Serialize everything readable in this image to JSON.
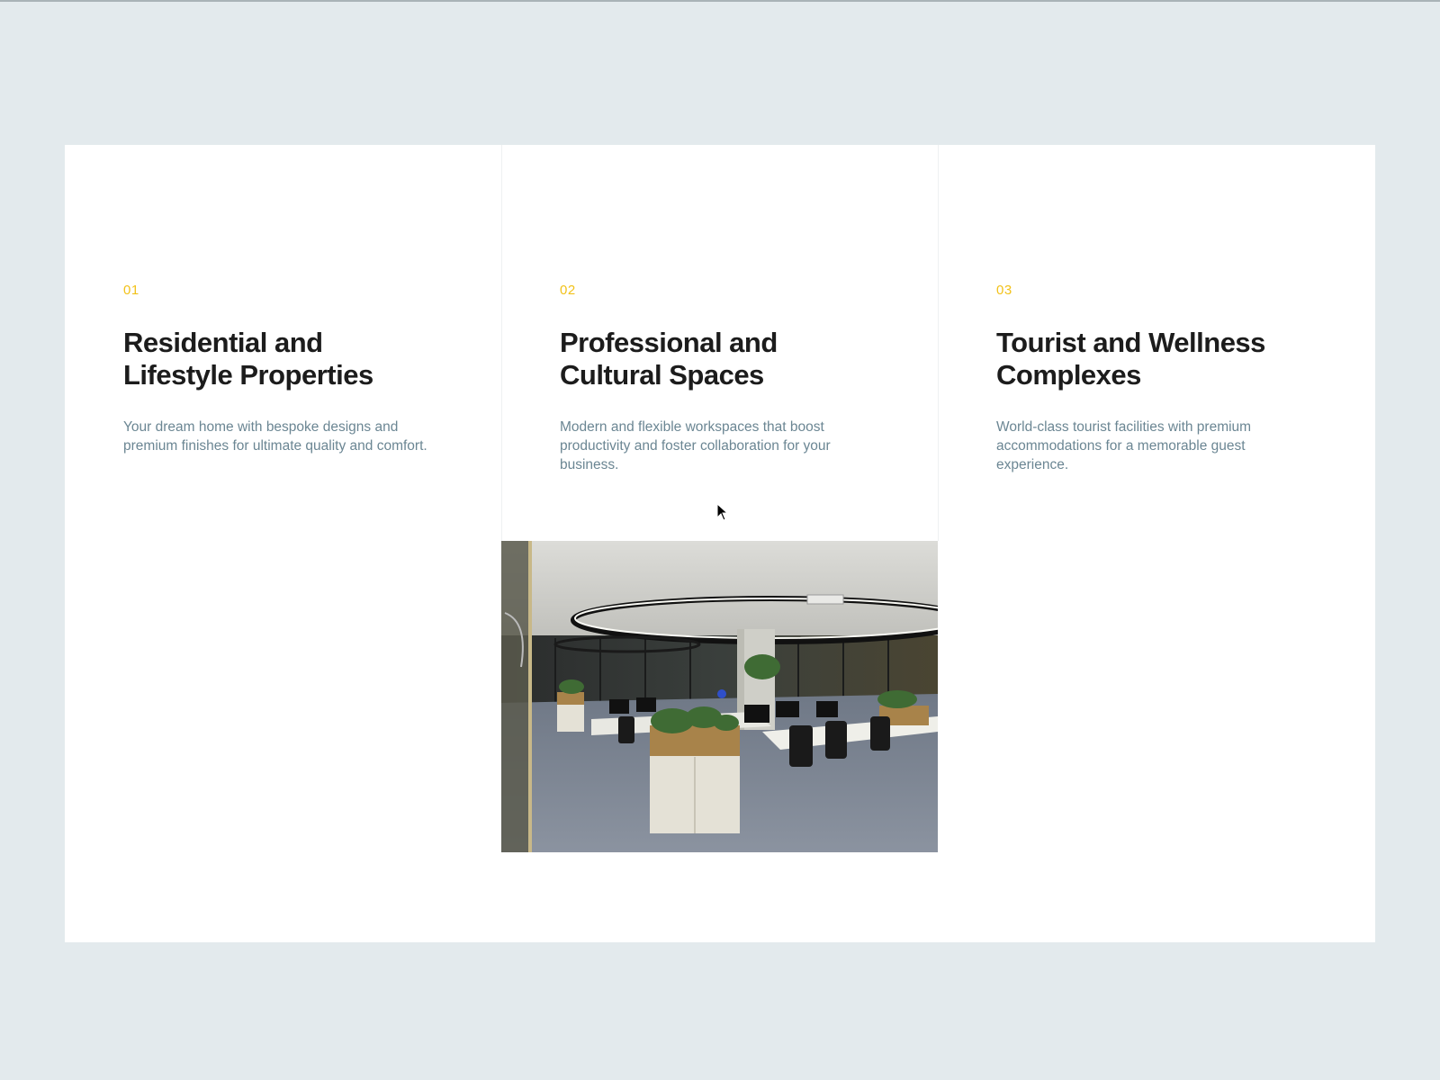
{
  "cards": [
    {
      "number": "01",
      "title_line1": "Residential and",
      "title_line2": "Lifestyle Properties",
      "description": "Your dream home with bespoke designs and premium finishes for ultimate quality and comfort."
    },
    {
      "number": "02",
      "title_line1": "Professional and",
      "title_line2": "Cultural Spaces",
      "description": "Modern and flexible workspaces that boost productivity and foster collaboration for your business.",
      "image": "office-interior-photo"
    },
    {
      "number": "03",
      "title_line1": "Tourist and Wellness",
      "title_line2": "Complexes",
      "description": "World-class tourist facilities with premium accommodations for a memorable guest experience."
    }
  ],
  "colors": {
    "page_background": "#e3eaed",
    "panel_background": "#ffffff",
    "accent_number": "#f2c21a",
    "title_text": "#1c1c1c",
    "description_text": "#6b8693"
  }
}
